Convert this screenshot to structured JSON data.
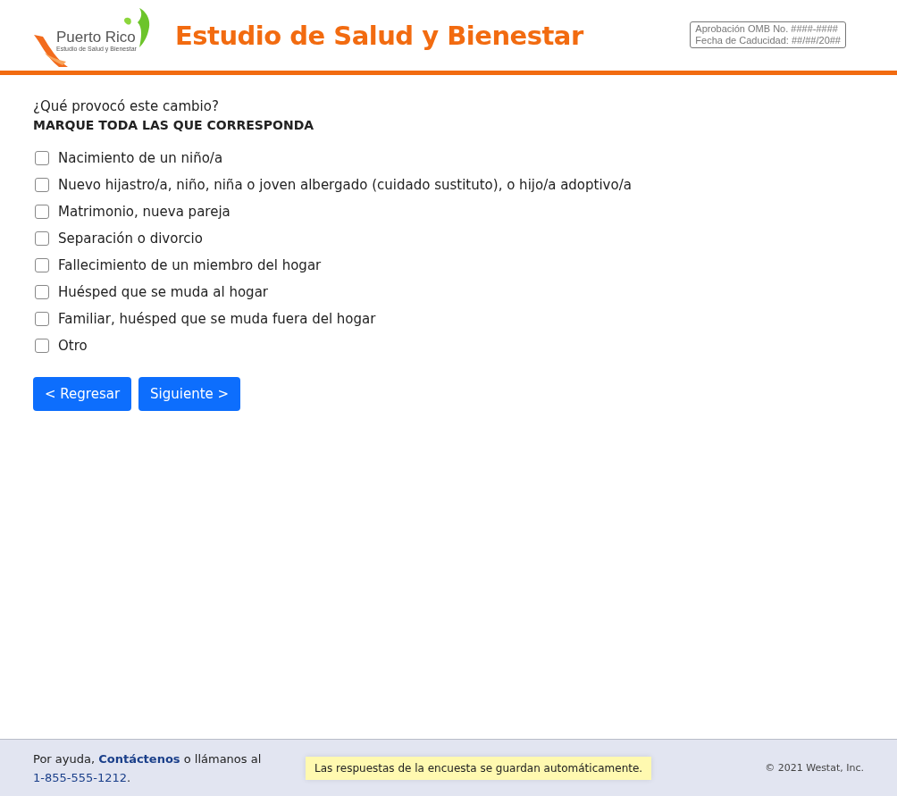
{
  "header": {
    "logo": {
      "name": "Puerto Rico",
      "subtitle": "Estudio de Salud y Bienestar"
    },
    "title": "Estudio de Salud y Bienestar",
    "omb": [
      "Aprobación OMB No. ####-####",
      "Fecha de Caducidad: ##/##/20##"
    ]
  },
  "question": {
    "text": "¿Qué provocó este cambio?",
    "instruction": "MARQUE TODA LAS QUE CORRESPONDA",
    "options": [
      {
        "label": "Nacimiento de un niño/a",
        "checked": false
      },
      {
        "label": "Nuevo hijastro/a, niño, niña o joven albergado (cuidado sustituto), o hijo/a adoptivo/a",
        "checked": false
      },
      {
        "label": "Matrimonio, nueva pareja",
        "checked": false
      },
      {
        "label": "Separación o divorcio",
        "checked": false
      },
      {
        "label": "Fallecimiento de un miembro del hogar",
        "checked": false
      },
      {
        "label": "Huésped que se muda al hogar",
        "checked": false
      },
      {
        "label": "Familiar, huésped que se muda fuera del hogar",
        "checked": false
      },
      {
        "label": "Otro",
        "checked": false
      }
    ]
  },
  "buttons": [
    "< Regresar",
    "Siguiente >"
  ],
  "footer": {
    "help": {
      "prefix": "Por ayuda,",
      "link": "Contáctenos",
      "middle": "o llámanos al",
      "phone": "1-855-555-1212",
      "suffix": "."
    },
    "notice": "Las respuestas de la encuesta se guardan automáticamente.",
    "copyright": "© 2021 Westat, Inc."
  }
}
